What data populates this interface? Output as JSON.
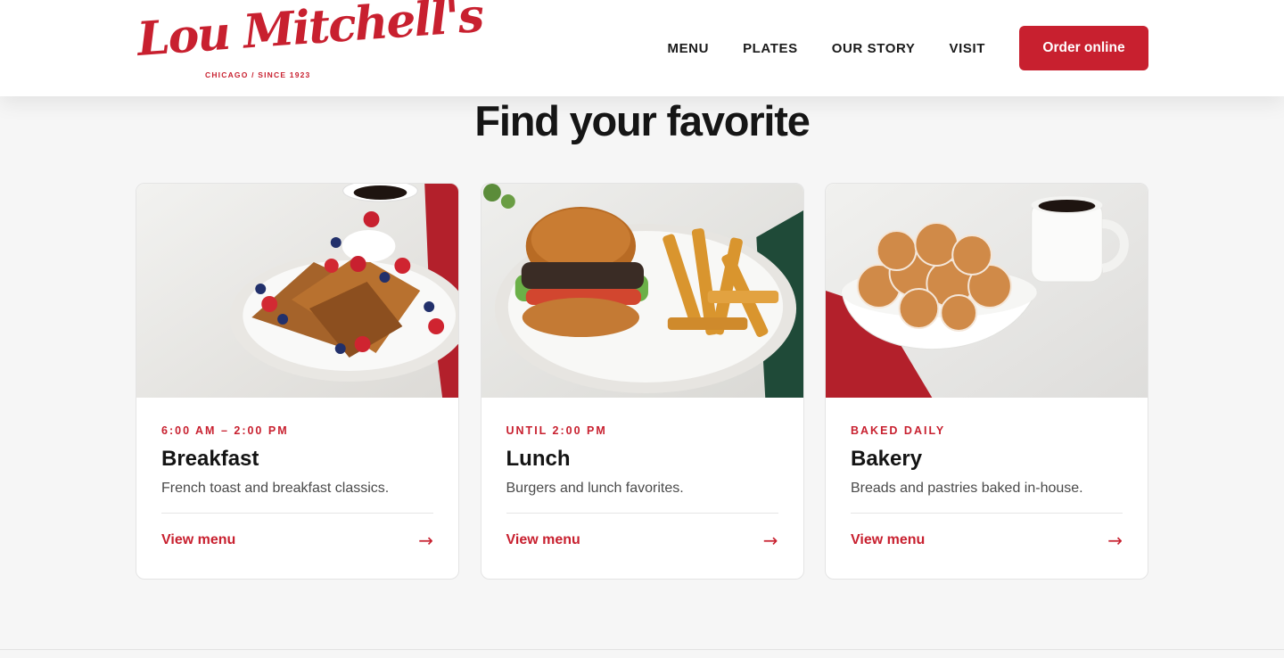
{
  "brand": {
    "name": "Lou Mitchell's",
    "tagline": "CHICAGO / SINCE 1923",
    "accent_color": "#c8202f"
  },
  "nav": {
    "items": [
      {
        "label": "MENU"
      },
      {
        "label": "PLATES"
      },
      {
        "label": "OUR STORY"
      },
      {
        "label": "VISIT"
      }
    ],
    "cta_label": "Order online"
  },
  "section": {
    "title": "Find your favorite"
  },
  "cards": [
    {
      "eyebrow": "6:00 AM – 2:00 PM",
      "title": "Breakfast",
      "description": "French toast and breakfast classics.",
      "link_label": "View menu",
      "arrow": "→",
      "image_icon": "french-toast-photo"
    },
    {
      "eyebrow": "UNTIL 2:00 PM",
      "title": "Lunch",
      "description": "Burgers and lunch favorites.",
      "link_label": "View menu",
      "arrow": "→",
      "image_icon": "burger-photo"
    },
    {
      "eyebrow": "BAKED DAILY",
      "title": "Bakery",
      "description": "Breads and pastries baked in-house.",
      "link_label": "View menu",
      "arrow": "→",
      "image_icon": "donut-holes-photo"
    }
  ]
}
